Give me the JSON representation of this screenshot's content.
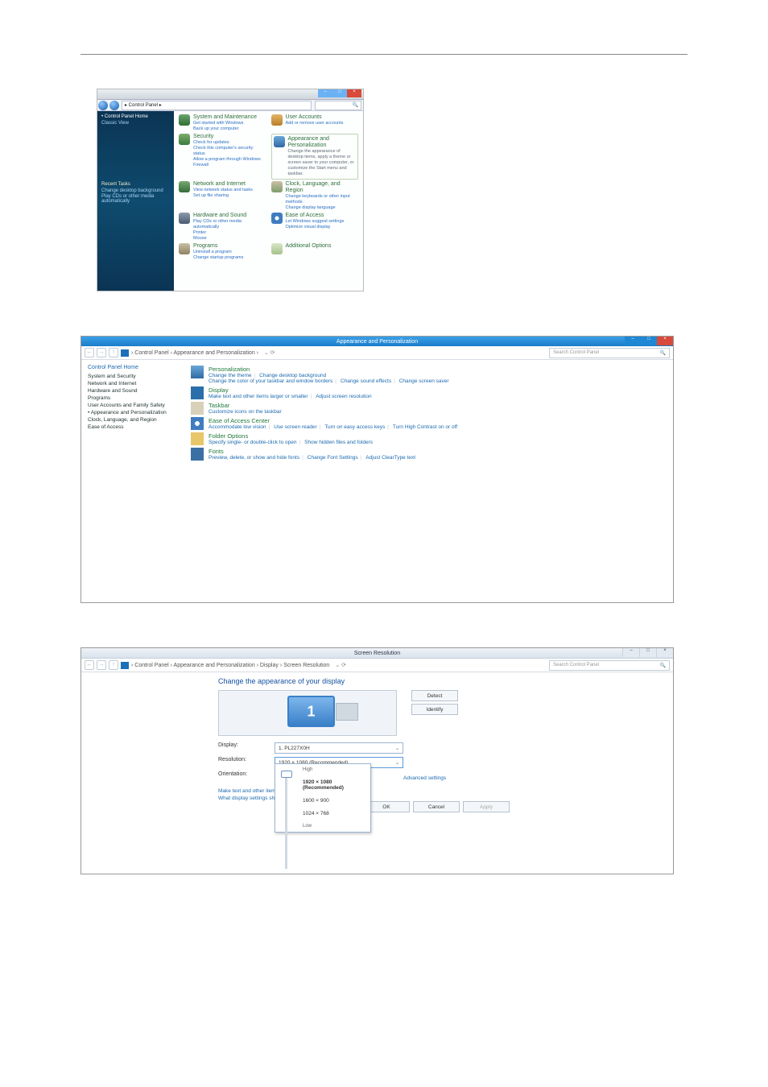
{
  "shot1": {
    "title_prefix": "▸",
    "address": "▸ Control Panel ▸",
    "search_icon": "🔍",
    "sidebar": {
      "heading": "Control Panel Home",
      "classic": "Classic View",
      "recent_heading": "Recent Tasks",
      "recent_items": [
        "Change desktop background",
        "Play CDs or other media automatically"
      ]
    },
    "cats": {
      "sys": {
        "t": "System and Maintenance",
        "l": [
          "Get started with Windows",
          "Back up your computer"
        ]
      },
      "sec": {
        "t": "Security",
        "l": [
          "Check for updates",
          "Check this computer's security status",
          "Allow a program through Windows Firewall"
        ]
      },
      "net": {
        "t": "Network and Internet",
        "l": [
          "View network status and tasks",
          "Set up file sharing"
        ]
      },
      "hw": {
        "t": "Hardware and Sound",
        "l": [
          "Play CDs or other media automatically",
          "Printer",
          "Mouse"
        ]
      },
      "prg": {
        "t": "Programs",
        "l": [
          "Uninstall a program",
          "Change startup programs"
        ]
      },
      "usr": {
        "t": "User Accounts",
        "l": [
          "Add or remove user accounts"
        ]
      },
      "app": {
        "t": "Appearance and Personalization",
        "l": [
          "Change the appearance of desktop items, apply a theme or screen saver to your computer, or customize the Start menu and taskbar."
        ]
      },
      "clk": {
        "t": "Clock, Language, and Region",
        "l": [
          "Change keyboards or other input methods",
          "Change display language"
        ]
      },
      "eoa": {
        "t": "Ease of Access",
        "l": [
          "Let Windows suggest settings",
          "Optimize visual display"
        ]
      },
      "add": {
        "t": "Additional Options",
        "l": []
      }
    }
  },
  "shot2": {
    "title": "Appearance and Personalization",
    "breadcrumb": "› Control Panel › Appearance and Personalization ›",
    "view_label": "⌄  ⟳",
    "search_placeholder": "Search Control Panel",
    "side": {
      "home": "Control Panel Home",
      "items": [
        "System and Security",
        "Network and Internet",
        "Hardware and Sound",
        "Programs",
        "User Accounts and Family Safety",
        "Appearance and Personalization",
        "Clock, Language, and Region",
        "Ease of Access"
      ]
    },
    "groups": [
      {
        "t": "Personalization",
        "l": [
          "Change the theme",
          "Change desktop background",
          "Change the color of your taskbar and window borders",
          "Change sound effects",
          "Change screen saver"
        ]
      },
      {
        "t": "Display",
        "l": [
          "Make text and other items larger or smaller",
          "Adjust screen resolution"
        ]
      },
      {
        "t": "Taskbar",
        "l": [
          "Customize icons on the taskbar"
        ]
      },
      {
        "t": "Ease of Access Center",
        "l": [
          "Accommodate low vision",
          "Use screen reader",
          "Turn on easy access keys",
          "Turn High Contrast on or off"
        ]
      },
      {
        "t": "Folder Options",
        "l": [
          "Specify single- or double-click to open",
          "Show hidden files and folders"
        ]
      },
      {
        "t": "Fonts",
        "l": [
          "Preview, delete, or show and hide fonts",
          "Change Font Settings",
          "Adjust ClearType text"
        ]
      }
    ],
    "win_buttons": {
      "min": "–",
      "max": "□",
      "close": "×"
    }
  },
  "shot3": {
    "title": "Screen Resolution",
    "breadcrumb": "› Control Panel › Appearance and Personalization › Display › Screen Resolution",
    "search_placeholder": "Search Control Panel",
    "heading": "Change the appearance of your display",
    "detect": "Detect",
    "identify": "Identify",
    "labels": {
      "display": "Display:",
      "resolution": "Resolution:",
      "orientation": "Orientation:"
    },
    "display_value": "1. PL227X0H",
    "resolution_value": "1920 × 1080 (Recommended)",
    "popup": {
      "high": "High",
      "opts": [
        "1920 × 1080 (Recommended)",
        "1600 × 900",
        "",
        "",
        "1024 × 768"
      ],
      "low": "Low"
    },
    "links": {
      "make": "Make text and other items larger or smaller",
      "what": "What display settings should I choose?",
      "adv": "Advanced settings"
    },
    "buttons": {
      "ok": "OK",
      "cancel": "Cancel",
      "apply": "Apply"
    },
    "win_buttons": {
      "min": "–",
      "max": "□",
      "close": "×"
    }
  }
}
